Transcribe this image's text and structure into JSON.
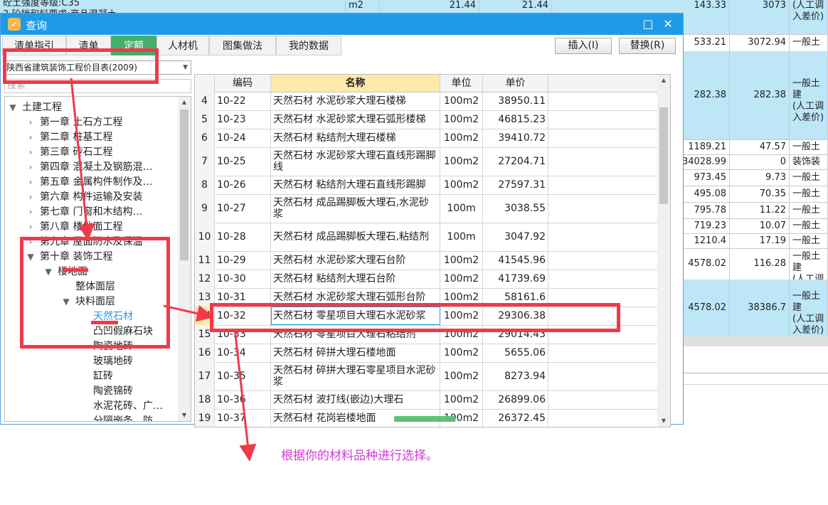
{
  "background_sheet": {
    "rows": [
      {
        "c1": "砼土强度等级:C35",
        "c1b": "3.砼拌和料要求:商品混凝土",
        "unit": "m2",
        "q1": "21.44",
        "q2": "21.44",
        "a": "143.33",
        "b": "3073",
        "desc": "(人工调",
        "desc2": "入差价)"
      },
      {
        "a": "533.21",
        "b": "3072.94",
        "desc": "一般土建"
      },
      {
        "a": "282.38",
        "b": "282.38",
        "desc": "一般土建",
        "desc2": "(人工调",
        "desc3": "入差价)"
      },
      {
        "a": "1189.21",
        "b": "47.57",
        "desc": "一般土建"
      },
      {
        "a": "34028.99",
        "b": "0",
        "desc": "装饰装修"
      },
      {
        "a": "973.45",
        "b": "9.73",
        "desc": "一般土建"
      },
      {
        "a": "495.08",
        "b": "70.35",
        "desc": "一般土建"
      },
      {
        "a": "795.78",
        "b": "11.22",
        "desc": "一般土建"
      },
      {
        "a": "719.23",
        "b": "10.07",
        "desc": "一般土建"
      },
      {
        "a": "1210.4",
        "b": "17.19",
        "desc": "一般土建"
      },
      {
        "a": "4578.02",
        "b": "116.28",
        "desc": "一般土建",
        "desc2": "(人工调"
      },
      {
        "a": "4578.02",
        "b": "38386.7",
        "desc": "一般土建",
        "desc2": "(人工调",
        "desc3": "入差价)"
      }
    ]
  },
  "dialog": {
    "title": "查询",
    "maximize_glyph": "□",
    "close_glyph": "✕",
    "tabs": [
      "清单指引",
      "清单",
      "定额",
      "人材机",
      "图集做法",
      "我的数据"
    ],
    "active_tab": "定额",
    "insert_label": "插入(I)",
    "replace_label": "替换(R)"
  },
  "left_panel": {
    "library_select": "陕西省建筑装饰工程价目表(2009)",
    "search_placeholder": "搜索",
    "tree": [
      {
        "label": "土建工程",
        "arrow": "▼",
        "level": 0
      },
      {
        "label": "第一章  土石方工程",
        "arrow": "›",
        "level": 1
      },
      {
        "label": "第二章  桩基工程",
        "arrow": "›",
        "level": 1
      },
      {
        "label": "第三章  砖石工程",
        "arrow": "›",
        "level": 1
      },
      {
        "label": "第四章  混凝土及钢筋混…",
        "arrow": "›",
        "level": 1
      },
      {
        "label": "第五章  金属构件制作及…",
        "arrow": "›",
        "level": 1
      },
      {
        "label": "第六章  构件运输及安装",
        "arrow": "›",
        "level": 1
      },
      {
        "label": "第七章  门窗和木结构…",
        "arrow": "›",
        "level": 1
      },
      {
        "label": "第八章  楼地面工程",
        "arrow": "›",
        "level": 1
      },
      {
        "label": "第九章  屋面防水及保温",
        "arrow": "›",
        "level": 1
      },
      {
        "label": "第十章  装饰工程",
        "arrow": "▼",
        "level": 1
      },
      {
        "label": "楼地面",
        "arrow": "▼",
        "level": 2
      },
      {
        "label": "整体面层",
        "arrow": "",
        "level": 3
      },
      {
        "label": "块料面层",
        "arrow": "▼",
        "level": 3
      },
      {
        "label": "天然石材",
        "arrow": "",
        "level": 4,
        "selected": true
      },
      {
        "label": "凸凹假麻石块",
        "arrow": "",
        "level": 4
      },
      {
        "label": "陶瓷地砖",
        "arrow": "",
        "level": 4
      },
      {
        "label": "玻璃地砖",
        "arrow": "",
        "level": 4
      },
      {
        "label": "缸砖",
        "arrow": "",
        "level": 4
      },
      {
        "label": "陶瓷锦砖",
        "arrow": "",
        "level": 4
      },
      {
        "label": "水泥花砖、广…",
        "arrow": "",
        "level": 4
      },
      {
        "label": "分隔嵌条、防…",
        "arrow": "",
        "level": 4
      }
    ]
  },
  "grid": {
    "headers": {
      "code": "编码",
      "name": "名称",
      "unit": "单位",
      "price": "单价"
    },
    "rows": [
      {
        "num": "4",
        "code": "10-22",
        "name": "天然石材  水泥砂浆大理石楼梯",
        "unit": "100m2",
        "price": "38950.11"
      },
      {
        "num": "5",
        "code": "10-23",
        "name": "天然石材  水泥砂浆大理石弧形楼梯",
        "unit": "100m2",
        "price": "46815.23"
      },
      {
        "num": "6",
        "code": "10-24",
        "name": "天然石材  粘结剂大理石楼梯",
        "unit": "100m2",
        "price": "39410.72"
      },
      {
        "num": "7",
        "code": "10-25",
        "name": "天然石材  水泥砂浆大理石直线形踢脚线",
        "unit": "100m2",
        "price": "27204.71"
      },
      {
        "num": "8",
        "code": "10-26",
        "name": "天然石材  粘结剂大理石直线形踢脚",
        "unit": "100m2",
        "price": "27597.31"
      },
      {
        "num": "9",
        "code": "10-27",
        "name": "天然石材  成品踢脚板大理石,水泥砂浆",
        "unit": "100m",
        "price": "3038.55"
      },
      {
        "num": "10",
        "code": "10-28",
        "name": "天然石材  成品踢脚板大理石,粘结剂",
        "unit": "100m",
        "price": "3047.92"
      },
      {
        "num": "11",
        "code": "10-29",
        "name": "天然石材  水泥砂浆大理石台阶",
        "unit": "100m2",
        "price": "41545.96"
      },
      {
        "num": "12",
        "code": "10-30",
        "name": "天然石材  粘结剂大理石台阶",
        "unit": "100m2",
        "price": "41739.69"
      },
      {
        "num": "13",
        "code": "10-31",
        "name": "天然石材  水泥砂浆大理石弧形台阶",
        "unit": "100m2",
        "price": "58161.6"
      },
      {
        "num": "14",
        "code": "10-32",
        "name": "天然石材  零星项目大理石水泥砂浆",
        "unit": "100m2",
        "price": "29306.38",
        "selected": true
      },
      {
        "num": "15",
        "code": "10-33",
        "name": "天然石材  零星项目大理石粘结剂",
        "unit": "100m2",
        "price": "29014.43"
      },
      {
        "num": "16",
        "code": "10-34",
        "name": "天然石材  碎拼大理石楼地面",
        "unit": "100m2",
        "price": "5655.06"
      },
      {
        "num": "17",
        "code": "10-35",
        "name": "天然石材  碎拼大理石零星项目水泥砂浆",
        "unit": "100m2",
        "price": "8273.94"
      },
      {
        "num": "18",
        "code": "10-36",
        "name": "天然石材  波打线(嵌边)大理石",
        "unit": "100m2",
        "price": "26899.06"
      },
      {
        "num": "19",
        "code": "10-37",
        "name": "天然石材  花岗岩楼地面",
        "unit": "100m2",
        "price": "26372.45"
      }
    ]
  },
  "annotation": {
    "note": "根据你的材料品种进行选择。"
  },
  "colors": {
    "title_bar": "#1e9be8",
    "active_tab": "#42b06b",
    "selection": "#fde9a8",
    "annotation_red": "#ef3a4a",
    "note_magenta": "#d23ad6",
    "sheet_blue": "#bde6f7"
  }
}
